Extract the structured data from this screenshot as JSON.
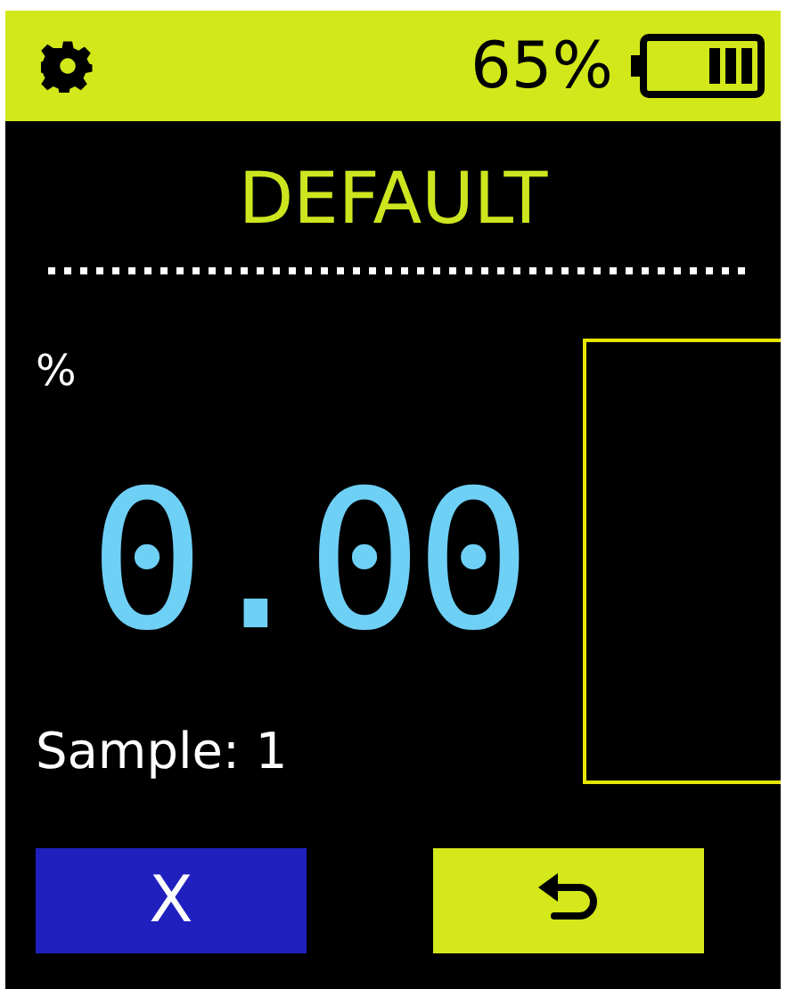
{
  "status_bar": {
    "battery": "65%"
  },
  "title": "DEFAULT",
  "reading": {
    "unit": "%",
    "value": "0.00",
    "sample": "Sample: 1"
  },
  "buttons": [
    {
      "kind": "text",
      "label": "X"
    },
    {
      "kind": "back"
    }
  ]
}
